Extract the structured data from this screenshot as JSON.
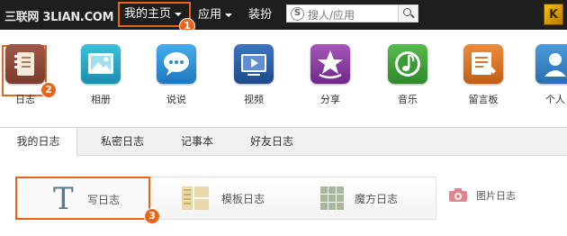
{
  "topbar": {
    "logo": "三联网 3LIAN.COM",
    "nav": {
      "home": "我的主页",
      "app": "应用",
      "dress": "装扮"
    },
    "search": {
      "placeholder": "搜人/应用"
    },
    "avatar_letter": "K"
  },
  "badges": [
    "1",
    "2",
    "3"
  ],
  "apps": [
    {
      "label": "日志",
      "icon": "diary-icon",
      "color": "#8a4a3c"
    },
    {
      "label": "相册",
      "icon": "photo-album-icon",
      "color": "#27a7c6"
    },
    {
      "label": "说说",
      "icon": "speech-bubble-icon",
      "color": "#2a8fcf"
    },
    {
      "label": "视频",
      "icon": "video-icon",
      "color": "#2c5fa8"
    },
    {
      "label": "分享",
      "icon": "share-star-icon",
      "color": "#8b3fa0"
    },
    {
      "label": "音乐",
      "icon": "music-icon",
      "color": "#3d9b37"
    },
    {
      "label": "留言板",
      "icon": "message-board-icon",
      "color": "#d9762a"
    },
    {
      "label": "个人",
      "icon": "profile-icon",
      "color": "#3a87c8"
    }
  ],
  "tabs": [
    "我的日志",
    "私密日志",
    "记事本",
    "好友日志"
  ],
  "write": {
    "write_diary": "写日志",
    "template_diary": "模板日志",
    "cube_diary": "魔方日志",
    "photo_diary": "图片日志"
  },
  "colors": {
    "accent": "#e8641b",
    "topbar": "#1e1e1e"
  }
}
